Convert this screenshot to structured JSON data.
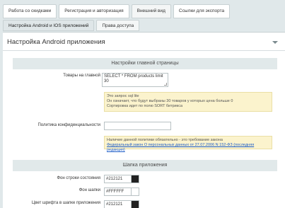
{
  "top_tabs": [
    {
      "label": "Работа со скидками"
    },
    {
      "label": "Регистрация и авторизация"
    },
    {
      "label": "Внешний вид"
    },
    {
      "label": "Ссылки для экспорта"
    }
  ],
  "sub_tabs": [
    {
      "label": "Настройка Android и IOS приложений"
    },
    {
      "label": "Права доступа"
    }
  ],
  "section": {
    "title": "Настройка Android приложения"
  },
  "main_page": {
    "heading": "Настройки главной страницы",
    "products_label": "Товары на главной",
    "products_value": "SELECT * FROM products limit 30",
    "products_note": {
      "line1": "Это запрос sql lite",
      "line2": "Он означает, что будут выбраны 30 товаров у которых цена больше 0",
      "line3": "Сортировка идет по полю SORT битрикса"
    },
    "privacy_label": "Политика конфиденциальности",
    "privacy_value": "",
    "privacy_note": {
      "line1": "Наличие данной политики обязательно - это требование закона",
      "line2": "Федеральный закон О персональных данных от 27.07.2006 N 152-ФЗ (последняя редакция)"
    }
  },
  "header_section": {
    "heading": "Шапка приложения",
    "rows": [
      {
        "label": "Фон строки состояния",
        "value": "#212121",
        "color": "#212121"
      },
      {
        "label": "Фон шапки",
        "value": "#FFFFFF",
        "color": "#FFFFFF"
      },
      {
        "label": "Цвет шрифта в шапке приложения",
        "value": "#212121",
        "color": "#212121"
      }
    ]
  }
}
